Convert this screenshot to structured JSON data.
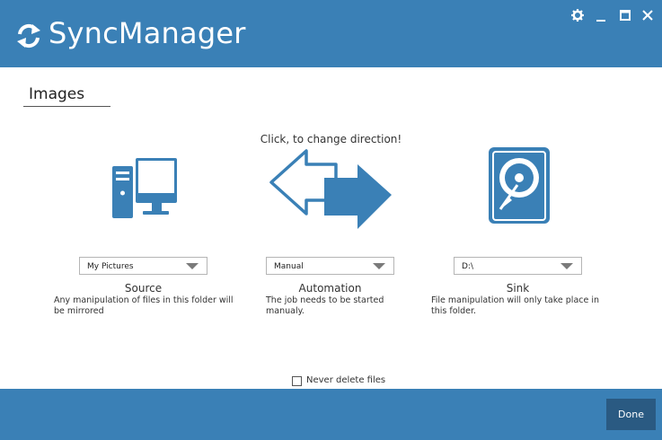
{
  "app": {
    "title": "SyncManager"
  },
  "window_controls": {
    "settings_icon": "gear-icon",
    "minimize_icon": "minimize-icon",
    "maximize_icon": "maximize-icon",
    "close_icon": "close-icon"
  },
  "job": {
    "name": "Images"
  },
  "direction_hint": "Click, to change direction!",
  "source": {
    "icon": "computer-icon",
    "selected": "My Pictures",
    "title": "Source",
    "description": "Any manipulation of files in this folder will be mirrored"
  },
  "automation": {
    "icon": "direction-arrows-icon",
    "selected": "Manual",
    "title": "Automation",
    "description": "The job needs to be started manualy."
  },
  "sink": {
    "icon": "hard-drive-icon",
    "selected": "D:\\",
    "title": "Sink",
    "description": "File manipulation will only take place in this folder."
  },
  "options": {
    "never_delete_label": "Never delete files",
    "never_delete_checked": false
  },
  "footer": {
    "done_label": "Done"
  },
  "colors": {
    "brand": "#3a80b6",
    "button_dark": "#2a5a82",
    "icon_blue": "#3a80b6"
  }
}
